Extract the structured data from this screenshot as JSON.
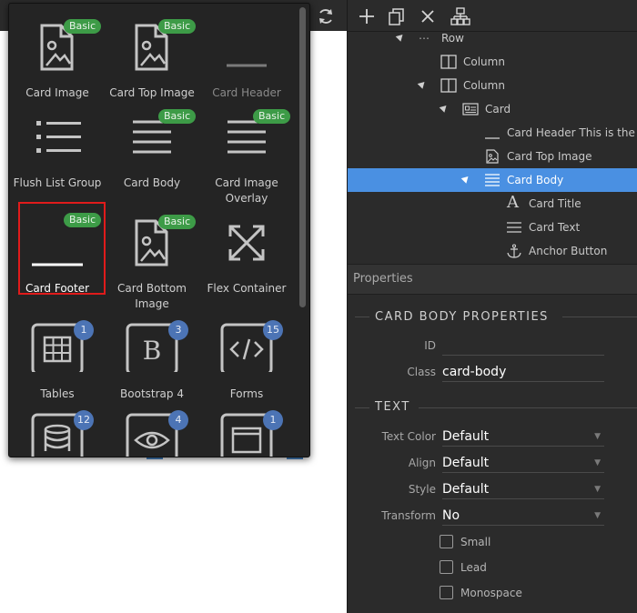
{
  "palette": {
    "items": [
      {
        "label": "Card Image",
        "icon": "image-file-icon",
        "badge": "Basic"
      },
      {
        "label": "Card Top Image",
        "icon": "image-file-icon",
        "badge": "Basic"
      },
      {
        "label": "Card Header",
        "icon": "line-icon",
        "badge": ""
      },
      {
        "label": "Flush List Group",
        "icon": "list-icon",
        "badge": ""
      },
      {
        "label": "Card Body",
        "icon": "lines-icon",
        "badge": "Basic"
      },
      {
        "label": "Card Image Overlay",
        "icon": "lines-icon",
        "badge": "Basic"
      },
      {
        "label": "Card Footer",
        "icon": "line-icon",
        "badge": "Basic"
      },
      {
        "label": "Card Bottom Image",
        "icon": "image-file-icon",
        "badge": "Basic"
      },
      {
        "label": "Flex Container",
        "icon": "expand-arrows-icon",
        "badge": ""
      },
      {
        "label": "Tables",
        "icon": "table-icon",
        "count": "1"
      },
      {
        "label": "Bootstrap 4",
        "icon": "b-letter-icon",
        "count": "3"
      },
      {
        "label": "Forms",
        "icon": "code-icon",
        "count": "15"
      },
      {
        "label": "",
        "icon": "database-icon",
        "count": "12"
      },
      {
        "label": "",
        "icon": "eye-icon",
        "count": "4"
      },
      {
        "label": "",
        "icon": "window-icon",
        "count": "1"
      }
    ]
  },
  "tree": {
    "nodes": [
      {
        "label": "Row",
        "icon": "ellipsis-icon"
      },
      {
        "label": "Column",
        "icon": "column-icon"
      },
      {
        "label": "Column",
        "icon": "column-icon"
      },
      {
        "label": "Card",
        "icon": "card-icon"
      },
      {
        "label": "Card Header This is the h",
        "icon": "line-icon"
      },
      {
        "label": "Card Top Image",
        "icon": "image-file-icon"
      },
      {
        "label": "Card Body",
        "icon": "lines-icon"
      },
      {
        "label": "Card Title",
        "icon": "letter-a-icon"
      },
      {
        "label": "Card Text",
        "icon": "lines-icon"
      },
      {
        "label": "Anchor Button",
        "icon": "anchor-icon"
      }
    ]
  },
  "properties": {
    "header": "Properties",
    "section_title": "CARD BODY PROPERTIES",
    "id_label": "ID",
    "id_value": "",
    "class_label": "Class",
    "class_value": "card-body",
    "text_section": "TEXT",
    "text_color_label": "Text Color",
    "text_color_value": "Default",
    "align_label": "Align",
    "align_value": "Default",
    "style_label": "Style",
    "style_value": "Default",
    "transform_label": "Transform",
    "transform_value": "No",
    "checkboxes": [
      {
        "label": "Small",
        "checked": false
      },
      {
        "label": "Lead",
        "checked": false
      },
      {
        "label": "Monospace",
        "checked": false
      }
    ]
  },
  "colors": {
    "selection": "#4a90e2",
    "basic_badge": "#3d9b47",
    "count_badge": "#4c74b5",
    "highlight_box": "#e01b1b"
  }
}
